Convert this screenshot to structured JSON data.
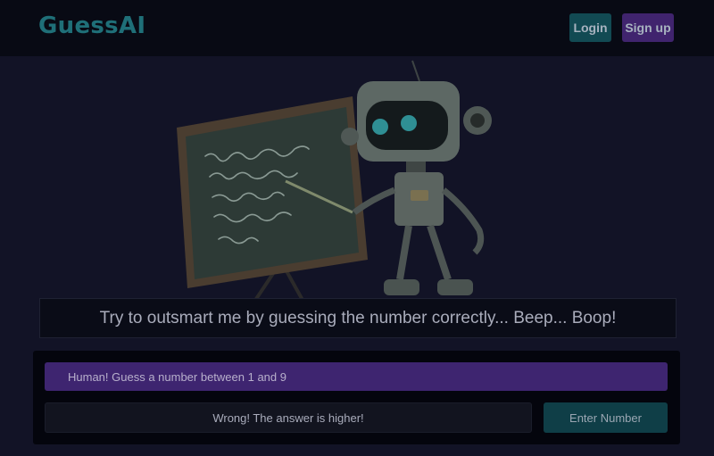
{
  "header": {
    "brand": "GuessAI",
    "login_label": "Login",
    "signup_label": "Sign up"
  },
  "hero": {
    "image_name": "robot-teacher-chalkboard"
  },
  "banner": {
    "text": "Try to outsmart me by guessing the number correctly... Beep... Boop!"
  },
  "game": {
    "prompt": "Human! Guess a number between 1 and 9",
    "feedback": "Wrong! The answer is higher!",
    "enter_label": "Enter Number"
  }
}
